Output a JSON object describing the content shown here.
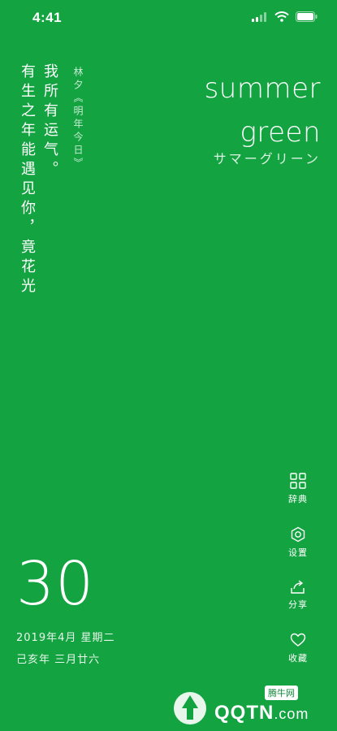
{
  "status": {
    "time": "4:41"
  },
  "poem": {
    "line1": "我所有运气。",
    "line2": "有生之年能遇见你，竟花光",
    "source": "林夕《明年今日》"
  },
  "title": {
    "en_line1": "summer",
    "en_line2": "green",
    "jp": "サマーグリーン"
  },
  "date": {
    "day": "30",
    "gregorian": "2019年4月 星期二",
    "lunar": "己亥年 三月廿六"
  },
  "actions": [
    {
      "icon": "grid-icon",
      "label": "辞典"
    },
    {
      "icon": "hexagon-settings-icon",
      "label": "设置"
    },
    {
      "icon": "share-icon",
      "label": "分享"
    },
    {
      "icon": "heart-icon",
      "label": "收藏"
    }
  ],
  "watermark": {
    "badge": "腾牛网",
    "brand": "QQTN",
    "suffix": ".com"
  },
  "colors": {
    "background": "#14a341",
    "text": "#ffffff"
  }
}
